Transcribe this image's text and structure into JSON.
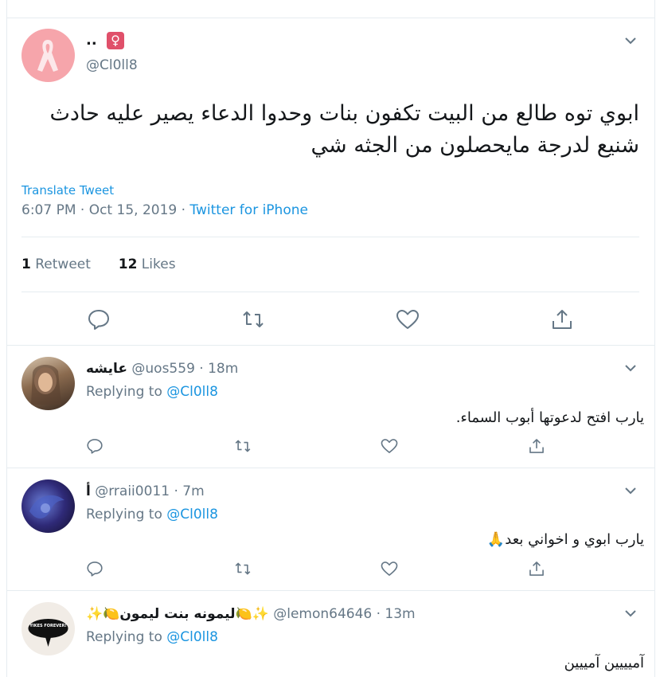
{
  "main_tweet": {
    "display_name": "..",
    "name_emoji": "♀",
    "handle": "@Cl0ll8",
    "text": "ابوي توه طالع من البيت تكفون بنات وحدوا الدعاء يصير عليه حادث شنيع لدرجة مايحصلون من الجثه شي",
    "translate": "Translate Tweet",
    "time": "6:07 PM · Oct 15, 2019 · ",
    "source": "Twitter for iPhone",
    "retweets_count": "1",
    "retweets_label": " Retweet",
    "likes_count": "12",
    "likes_label": " Likes"
  },
  "replies": [
    {
      "name": "عايشه",
      "handle": " @uos559 · 18m",
      "replying_label": "Replying to ",
      "replying_to": "@Cl0ll8",
      "text": "يارب افتح لدعوتها أبوب السماء."
    },
    {
      "name": "أ",
      "handle": " @rraii0011 · 7m",
      "replying_label": "Replying to ",
      "replying_to": "@Cl0ll8",
      "text": "يارب ابوي و اخواني بعد🙏"
    },
    {
      "name": "✨🍋ليمونه بنت ليمون🍋✨",
      "handle": " @lemon64646 · 13m",
      "replying_label": "Replying to ",
      "replying_to": "@Cl0ll8",
      "text": "آميييين آمييين",
      "avatar_text": "YIKES FOREVER!"
    }
  ],
  "colors": {
    "accent": "#1b95e0",
    "muted": "#657786",
    "border": "#e6ecf0",
    "text": "#14171a"
  },
  "icons": [
    "ribbon-icon",
    "chevron-down-icon",
    "reply-icon",
    "retweet-icon",
    "like-icon",
    "share-icon"
  ]
}
